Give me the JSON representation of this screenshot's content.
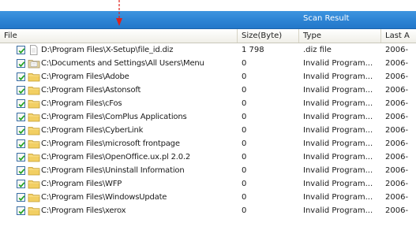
{
  "titlebar": {
    "title": "Scan Result"
  },
  "columns": {
    "file": "File",
    "size": "Size(Byte)",
    "type": "Type",
    "last": "Last A"
  },
  "rows": [
    {
      "checked": true,
      "icon": "file-icon",
      "path": "D:\\Program Files\\X-Setup\\file_id.diz",
      "size": "1 798",
      "type": ".diz file",
      "last": "2006-"
    },
    {
      "checked": true,
      "icon": "folder-documents-icon",
      "path": "C:\\Documents and Settings\\All Users\\Menu",
      "size": "0",
      "type": "Invalid Program...",
      "last": "2006-"
    },
    {
      "checked": true,
      "icon": "folder-icon",
      "path": "C:\\Program Files\\Adobe",
      "size": "0",
      "type": "Invalid Program...",
      "last": "2006-"
    },
    {
      "checked": true,
      "icon": "folder-icon",
      "path": "C:\\Program Files\\Astonsoft",
      "size": "0",
      "type": "Invalid Program...",
      "last": "2006-"
    },
    {
      "checked": true,
      "icon": "folder-icon",
      "path": "C:\\Program Files\\cFos",
      "size": "0",
      "type": "Invalid Program...",
      "last": "2006-"
    },
    {
      "checked": true,
      "icon": "folder-icon",
      "path": "C:\\Program Files\\ComPlus Applications",
      "size": "0",
      "type": "Invalid Program...",
      "last": "2006-"
    },
    {
      "checked": true,
      "icon": "folder-icon",
      "path": "C:\\Program Files\\CyberLink",
      "size": "0",
      "type": "Invalid Program...",
      "last": "2006-"
    },
    {
      "checked": true,
      "icon": "folder-icon",
      "path": "C:\\Program Files\\microsoft frontpage",
      "size": "0",
      "type": "Invalid Program...",
      "last": "2006-"
    },
    {
      "checked": true,
      "icon": "folder-icon",
      "path": "C:\\Program Files\\OpenOffice.ux.pl 2.0.2",
      "size": "0",
      "type": "Invalid Program...",
      "last": "2006-"
    },
    {
      "checked": true,
      "icon": "folder-icon",
      "path": "C:\\Program Files\\Uninstall Information",
      "size": "0",
      "type": "Invalid Program...",
      "last": "2006-"
    },
    {
      "checked": true,
      "icon": "folder-icon",
      "path": "C:\\Program Files\\WFP",
      "size": "0",
      "type": "Invalid Program...",
      "last": "2006-"
    },
    {
      "checked": true,
      "icon": "folder-icon",
      "path": "C:\\Program Files\\WindowsUpdate",
      "size": "0",
      "type": "Invalid Program...",
      "last": "2006-"
    },
    {
      "checked": true,
      "icon": "folder-icon",
      "path": "C:\\Program Files\\xerox",
      "size": "0",
      "type": "Invalid Program...",
      "last": "2006-"
    }
  ],
  "colors": {
    "titlebar": "#2f86d6",
    "marker": "#e0201a",
    "check": "#21a121",
    "folder": "#f2cf63"
  }
}
